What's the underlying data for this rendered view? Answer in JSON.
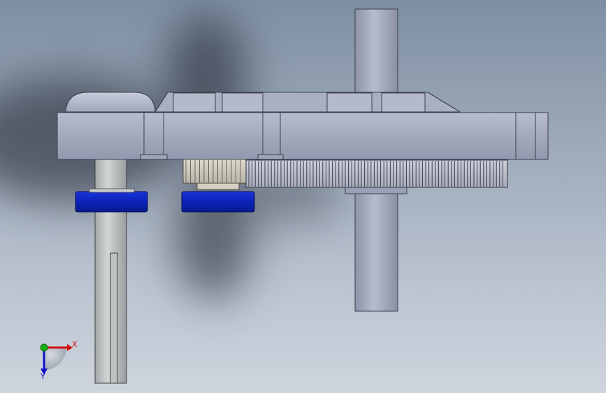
{
  "viewport": {
    "background_top": "#7f8fa3",
    "background_bottom": "#cfd5de"
  },
  "model": {
    "housing_color": "#a7adc0",
    "washer_color": "#0a1fb0",
    "shaft_color": "#c4c8c8",
    "output_shaft_color": "#9ea4b8",
    "gear_count": 2
  },
  "triad": {
    "x_label": "X",
    "y_label": "Y",
    "x_color": "#d01010",
    "y_color": "#14b014",
    "z_color": "#1010c8"
  }
}
